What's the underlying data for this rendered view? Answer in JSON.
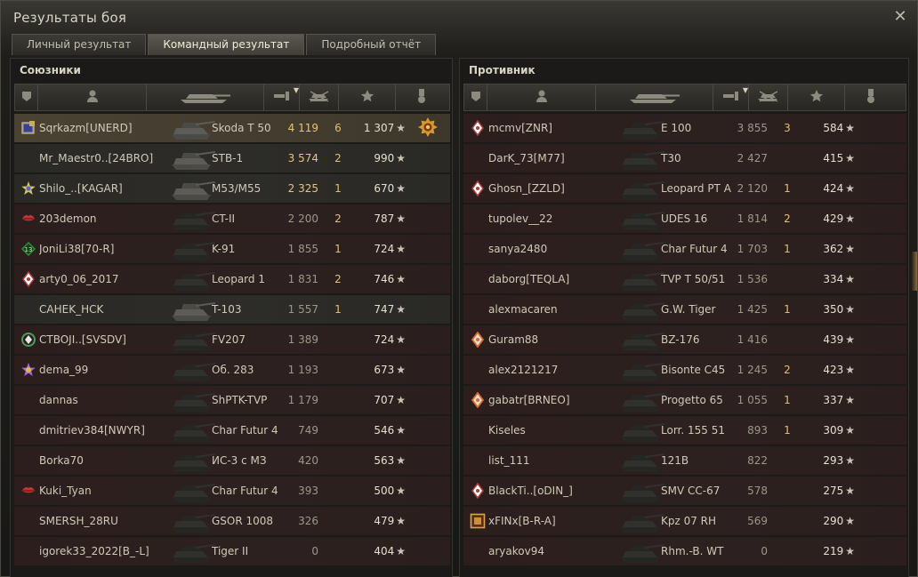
{
  "window": {
    "title": "Результаты боя",
    "close_icon": "close-icon"
  },
  "tabs": [
    {
      "label": "Личный результат",
      "active": false
    },
    {
      "label": "Командный результат",
      "active": true
    },
    {
      "label": "Подробный отчёт",
      "active": false
    }
  ],
  "columns": [
    {
      "id": "badge",
      "icon": "squad-icon"
    },
    {
      "id": "player",
      "icon": "player-icon"
    },
    {
      "id": "vehicle",
      "icon": "tank-icon"
    },
    {
      "id": "damage",
      "icon": "damage-icon",
      "sorted": true
    },
    {
      "id": "frags",
      "icon": "frags-icon"
    },
    {
      "id": "xp",
      "icon": "star-icon"
    },
    {
      "id": "medal",
      "icon": "medal-icon"
    }
  ],
  "allies": {
    "title": "Союзники",
    "rows": [
      {
        "name": "Sqrkazm[UNERD]",
        "badge": "gold-cube",
        "tank": "Skoda T 50",
        "damage": "4 119",
        "frags": "6",
        "xp": "1 307",
        "medal": true,
        "state": "me"
      },
      {
        "name": "Mr_Maestr0..[24BRO]",
        "badge": "",
        "tank": "STB-1",
        "damage": "3 574",
        "frags": "2",
        "xp": "990",
        "state": "alive"
      },
      {
        "name": "Shilo_..[KAGAR]",
        "badge": "gold-star",
        "tank": "M53/M55",
        "damage": "2 325",
        "frags": "1",
        "xp": "670",
        "state": "alive"
      },
      {
        "name": "203demon",
        "badge": "red-lips",
        "tank": "CT-II",
        "damage": "2 200",
        "frags": "2",
        "xp": "787",
        "state": "dead"
      },
      {
        "name": "JoniLi38[70-R]",
        "badge": "green-13",
        "tank": "K-91",
        "damage": "1 855",
        "frags": "1",
        "xp": "724",
        "state": "dead"
      },
      {
        "name": "arty0_06_2017",
        "badge": "diamond",
        "tank": "Leopard 1",
        "damage": "1 831",
        "frags": "2",
        "xp": "746",
        "state": "dead"
      },
      {
        "name": "CAHEK_HCK",
        "badge": "",
        "tank": "T-103",
        "damage": "1 557",
        "frags": "1",
        "xp": "747",
        "state": "alive"
      },
      {
        "name": "CTBOJI..[SVSDV]",
        "badge": "green-ring",
        "tank": "FV207",
        "damage": "1 389",
        "frags": "",
        "xp": "724",
        "state": "dead"
      },
      {
        "name": "dema_99",
        "badge": "purple-star",
        "tank": "Об. 283",
        "damage": "1 193",
        "frags": "",
        "xp": "673",
        "state": "dead"
      },
      {
        "name": "dannas",
        "badge": "",
        "tank": "ShPTK-TVP",
        "damage": "1 179",
        "frags": "",
        "xp": "707",
        "state": "dead"
      },
      {
        "name": "dmitriev384[NWYR]",
        "badge": "",
        "tank": "Char Futur 4",
        "damage": "749",
        "frags": "",
        "xp": "546",
        "state": "dead"
      },
      {
        "name": "Borka70",
        "badge": "",
        "tank": "ИС-3 с МЗ",
        "damage": "420",
        "frags": "",
        "xp": "563",
        "state": "dead"
      },
      {
        "name": "Kuki_Tyan",
        "badge": "red-lips",
        "tank": "Char Futur 4",
        "damage": "393",
        "frags": "",
        "xp": "500",
        "state": "dead"
      },
      {
        "name": "SMERSH_28RU",
        "badge": "",
        "tank": "GSOR 1008",
        "damage": "326",
        "frags": "",
        "xp": "479",
        "state": "dead"
      },
      {
        "name": "igorek33_2022[B_-L]",
        "badge": "",
        "tank": "Tiger II",
        "damage": "0",
        "frags": "",
        "xp": "404",
        "state": "dead"
      }
    ]
  },
  "enemies": {
    "title": "Противник",
    "rows": [
      {
        "name": "mcmv[ZNR]",
        "badge": "diamond",
        "tank": "E 100",
        "damage": "3 855",
        "frags": "3",
        "xp": "584",
        "state": "dead"
      },
      {
        "name": "DarK_73[M77]",
        "badge": "",
        "tank": "T30",
        "damage": "2 427",
        "frags": "",
        "xp": "415",
        "state": "dead"
      },
      {
        "name": "Ghosn_[ZZLD]",
        "badge": "diamond",
        "tank": "Leopard PT A",
        "damage": "2 120",
        "frags": "1",
        "xp": "424",
        "state": "dead"
      },
      {
        "name": "tupolev__22",
        "badge": "",
        "tank": "UDES 16",
        "damage": "1 814",
        "frags": "2",
        "xp": "429",
        "state": "dead"
      },
      {
        "name": "sanya2480",
        "badge": "",
        "tank": "Char Futur 4",
        "damage": "1 703",
        "frags": "1",
        "xp": "362",
        "state": "dead"
      },
      {
        "name": "daborg[TEQLA]",
        "badge": "",
        "tank": "TVP T 50/51",
        "damage": "1 536",
        "frags": "",
        "xp": "334",
        "state": "dead"
      },
      {
        "name": "alexmacaren",
        "badge": "",
        "tank": "G.W. Tiger",
        "damage": "1 425",
        "frags": "1",
        "xp": "350",
        "state": "dead"
      },
      {
        "name": "Guram88",
        "badge": "orange-diamond",
        "tank": "BZ-176",
        "damage": "1 416",
        "frags": "",
        "xp": "439",
        "state": "dead"
      },
      {
        "name": "alex2121217",
        "badge": "",
        "tank": "Bisonte C45",
        "damage": "1 245",
        "frags": "2",
        "xp": "423",
        "state": "dead"
      },
      {
        "name": "gabatr[BRNEO]",
        "badge": "orange-diamond",
        "tank": "Progetto 65",
        "damage": "1 055",
        "frags": "1",
        "xp": "337",
        "state": "dead"
      },
      {
        "name": "Kiseles",
        "badge": "",
        "tank": "Lorr. 155 51",
        "damage": "893",
        "frags": "1",
        "xp": "309",
        "state": "dead"
      },
      {
        "name": "list_111",
        "badge": "",
        "tank": "121B",
        "damage": "822",
        "frags": "",
        "xp": "293",
        "state": "dead"
      },
      {
        "name": "BlackTi..[oDIN_]",
        "badge": "diamond",
        "tank": "SMV CC-67",
        "damage": "578",
        "frags": "",
        "xp": "275",
        "state": "dead"
      },
      {
        "name": "xFINx[B-R-A]",
        "badge": "gold-frame",
        "tank": "Kpz 07 RH",
        "damage": "569",
        "frags": "",
        "xp": "290",
        "state": "dead"
      },
      {
        "name": "aryakov94",
        "badge": "",
        "tank": "Rhm.-B. WT",
        "damage": "0",
        "frags": "",
        "xp": "219",
        "state": "dead"
      }
    ]
  },
  "star_glyph": "★",
  "colors": {
    "ally_me": "#4a4233",
    "dead_row": "#2b1e1d",
    "frags": "#e0c06c",
    "damage_high": "#e7c576"
  }
}
